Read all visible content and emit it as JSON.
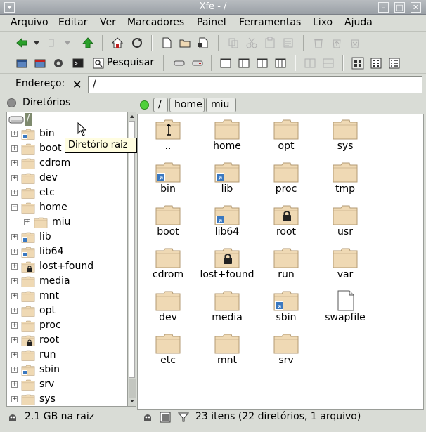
{
  "window": {
    "title": "Xfe - /",
    "controls": {
      "minimize": "–",
      "maximize": "□",
      "close": "✕"
    }
  },
  "menubar": [
    "Arquivo",
    "Editar",
    "Ver",
    "Marcadores",
    "Painel",
    "Ferramentas",
    "Lixo",
    "Ajuda"
  ],
  "toolbar": {
    "search_label": "Pesquisar"
  },
  "address": {
    "label": "Endereço:",
    "value": "/"
  },
  "left_panel": {
    "title": "Diretórios",
    "root_label": "/"
  },
  "tree": [
    {
      "label": "bin",
      "expander": "+",
      "indent": 0,
      "badge": "link"
    },
    {
      "label": "boot",
      "expander": "+",
      "indent": 0,
      "badge": ""
    },
    {
      "label": "cdrom",
      "expander": "+",
      "indent": 0,
      "badge": ""
    },
    {
      "label": "dev",
      "expander": "+",
      "indent": 0,
      "badge": ""
    },
    {
      "label": "etc",
      "expander": "+",
      "indent": 0,
      "badge": ""
    },
    {
      "label": "home",
      "expander": "−",
      "indent": 0,
      "badge": ""
    },
    {
      "label": "miu",
      "expander": "+",
      "indent": 1,
      "badge": ""
    },
    {
      "label": "lib",
      "expander": "+",
      "indent": 0,
      "badge": "link"
    },
    {
      "label": "lib64",
      "expander": "+",
      "indent": 0,
      "badge": "link"
    },
    {
      "label": "lost+found",
      "expander": "+",
      "indent": 0,
      "badge": "lock"
    },
    {
      "label": "media",
      "expander": "+",
      "indent": 0,
      "badge": ""
    },
    {
      "label": "mnt",
      "expander": "+",
      "indent": 0,
      "badge": ""
    },
    {
      "label": "opt",
      "expander": "+",
      "indent": 0,
      "badge": ""
    },
    {
      "label": "proc",
      "expander": "+",
      "indent": 0,
      "badge": ""
    },
    {
      "label": "root",
      "expander": "+",
      "indent": 0,
      "badge": "lock"
    },
    {
      "label": "run",
      "expander": "+",
      "indent": 0,
      "badge": ""
    },
    {
      "label": "sbin",
      "expander": "+",
      "indent": 0,
      "badge": "link"
    },
    {
      "label": "srv",
      "expander": "+",
      "indent": 0,
      "badge": ""
    },
    {
      "label": "sys",
      "expander": "+",
      "indent": 0,
      "badge": ""
    }
  ],
  "tooltip": "Diretório raiz",
  "breadcrumb": [
    "/",
    "home",
    "miu"
  ],
  "files": [
    {
      "label": "..",
      "type": "parent"
    },
    {
      "label": "home",
      "type": "folder"
    },
    {
      "label": "opt",
      "type": "folder"
    },
    {
      "label": "sys",
      "type": "folder"
    },
    {
      "label": "bin",
      "type": "link"
    },
    {
      "label": "lib",
      "type": "link"
    },
    {
      "label": "proc",
      "type": "folder"
    },
    {
      "label": "tmp",
      "type": "folder"
    },
    {
      "label": "boot",
      "type": "folder"
    },
    {
      "label": "lib64",
      "type": "link"
    },
    {
      "label": "root",
      "type": "lock"
    },
    {
      "label": "usr",
      "type": "folder"
    },
    {
      "label": "cdrom",
      "type": "folder"
    },
    {
      "label": "lost+found",
      "type": "lock"
    },
    {
      "label": "run",
      "type": "folder"
    },
    {
      "label": "var",
      "type": "folder"
    },
    {
      "label": "dev",
      "type": "folder"
    },
    {
      "label": "media",
      "type": "folder"
    },
    {
      "label": "sbin",
      "type": "link"
    },
    {
      "label": "swapfile",
      "type": "file"
    },
    {
      "label": "etc",
      "type": "folder"
    },
    {
      "label": "mnt",
      "type": "folder"
    },
    {
      "label": "srv",
      "type": "folder"
    }
  ],
  "status": {
    "left": "2.1 GB na raiz",
    "right": "23 itens (22 diretórios, 1 arquivo)"
  },
  "colors": {
    "folder_fill": "#efd9b4",
    "folder_stroke": "#b39a73",
    "led_green": "#4fd03a",
    "led_gray": "#8c8c8c",
    "link_badge": "#3a78c0",
    "accent_home": "#c02020",
    "accent_green": "#2aa02a"
  }
}
